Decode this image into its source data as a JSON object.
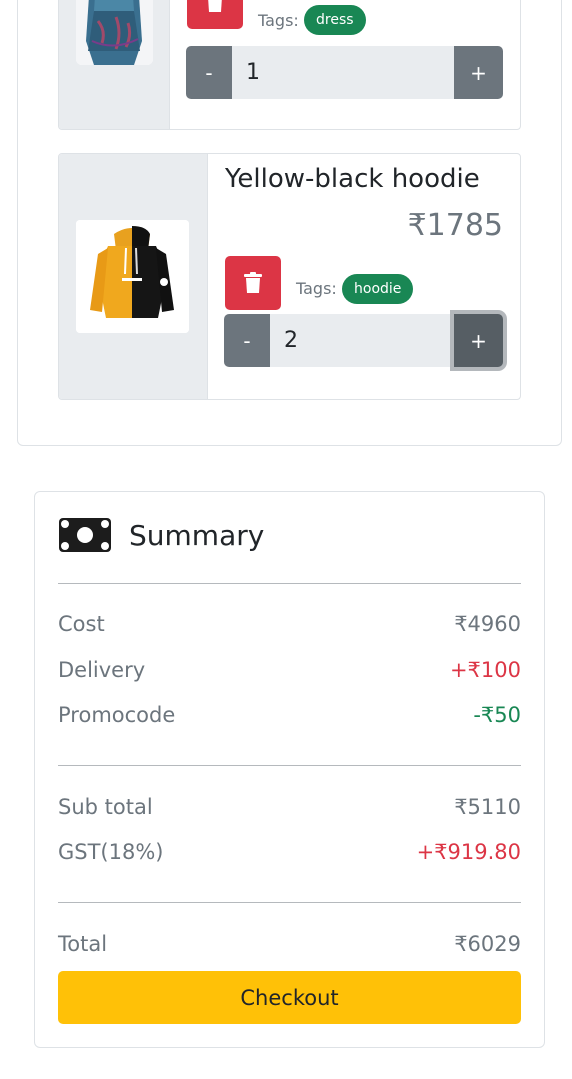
{
  "cart": {
    "items": [
      {
        "title": "",
        "price": "",
        "tags_label": "Tags:",
        "tag": "dress",
        "quantity": "1",
        "minus": "-",
        "plus": "+",
        "image_icon": "dress-image"
      },
      {
        "title": "Yellow-black hoodie",
        "price": "₹1785",
        "tags_label": "Tags:",
        "tag": "hoodie",
        "quantity": "2",
        "minus": "-",
        "plus": "+",
        "image_icon": "hoodie-image"
      }
    ]
  },
  "summary": {
    "icon": "money-icon",
    "title": "Summary",
    "cost_label": "Cost",
    "cost_value": "₹4960",
    "delivery_label": "Delivery",
    "delivery_value": "+₹100",
    "promo_label": "Promocode",
    "promo_value": "-₹50",
    "subtotal_label": "Sub total",
    "subtotal_value": "₹5110",
    "gst_label": "GST(18%)",
    "gst_value": "+₹919.80",
    "total_label": "Total",
    "total_value": "₹6029",
    "checkout_label": "Checkout"
  },
  "colors": {
    "danger": "#dc3545",
    "success": "#198754",
    "secondary": "#6c757d",
    "warning": "#ffc107"
  }
}
